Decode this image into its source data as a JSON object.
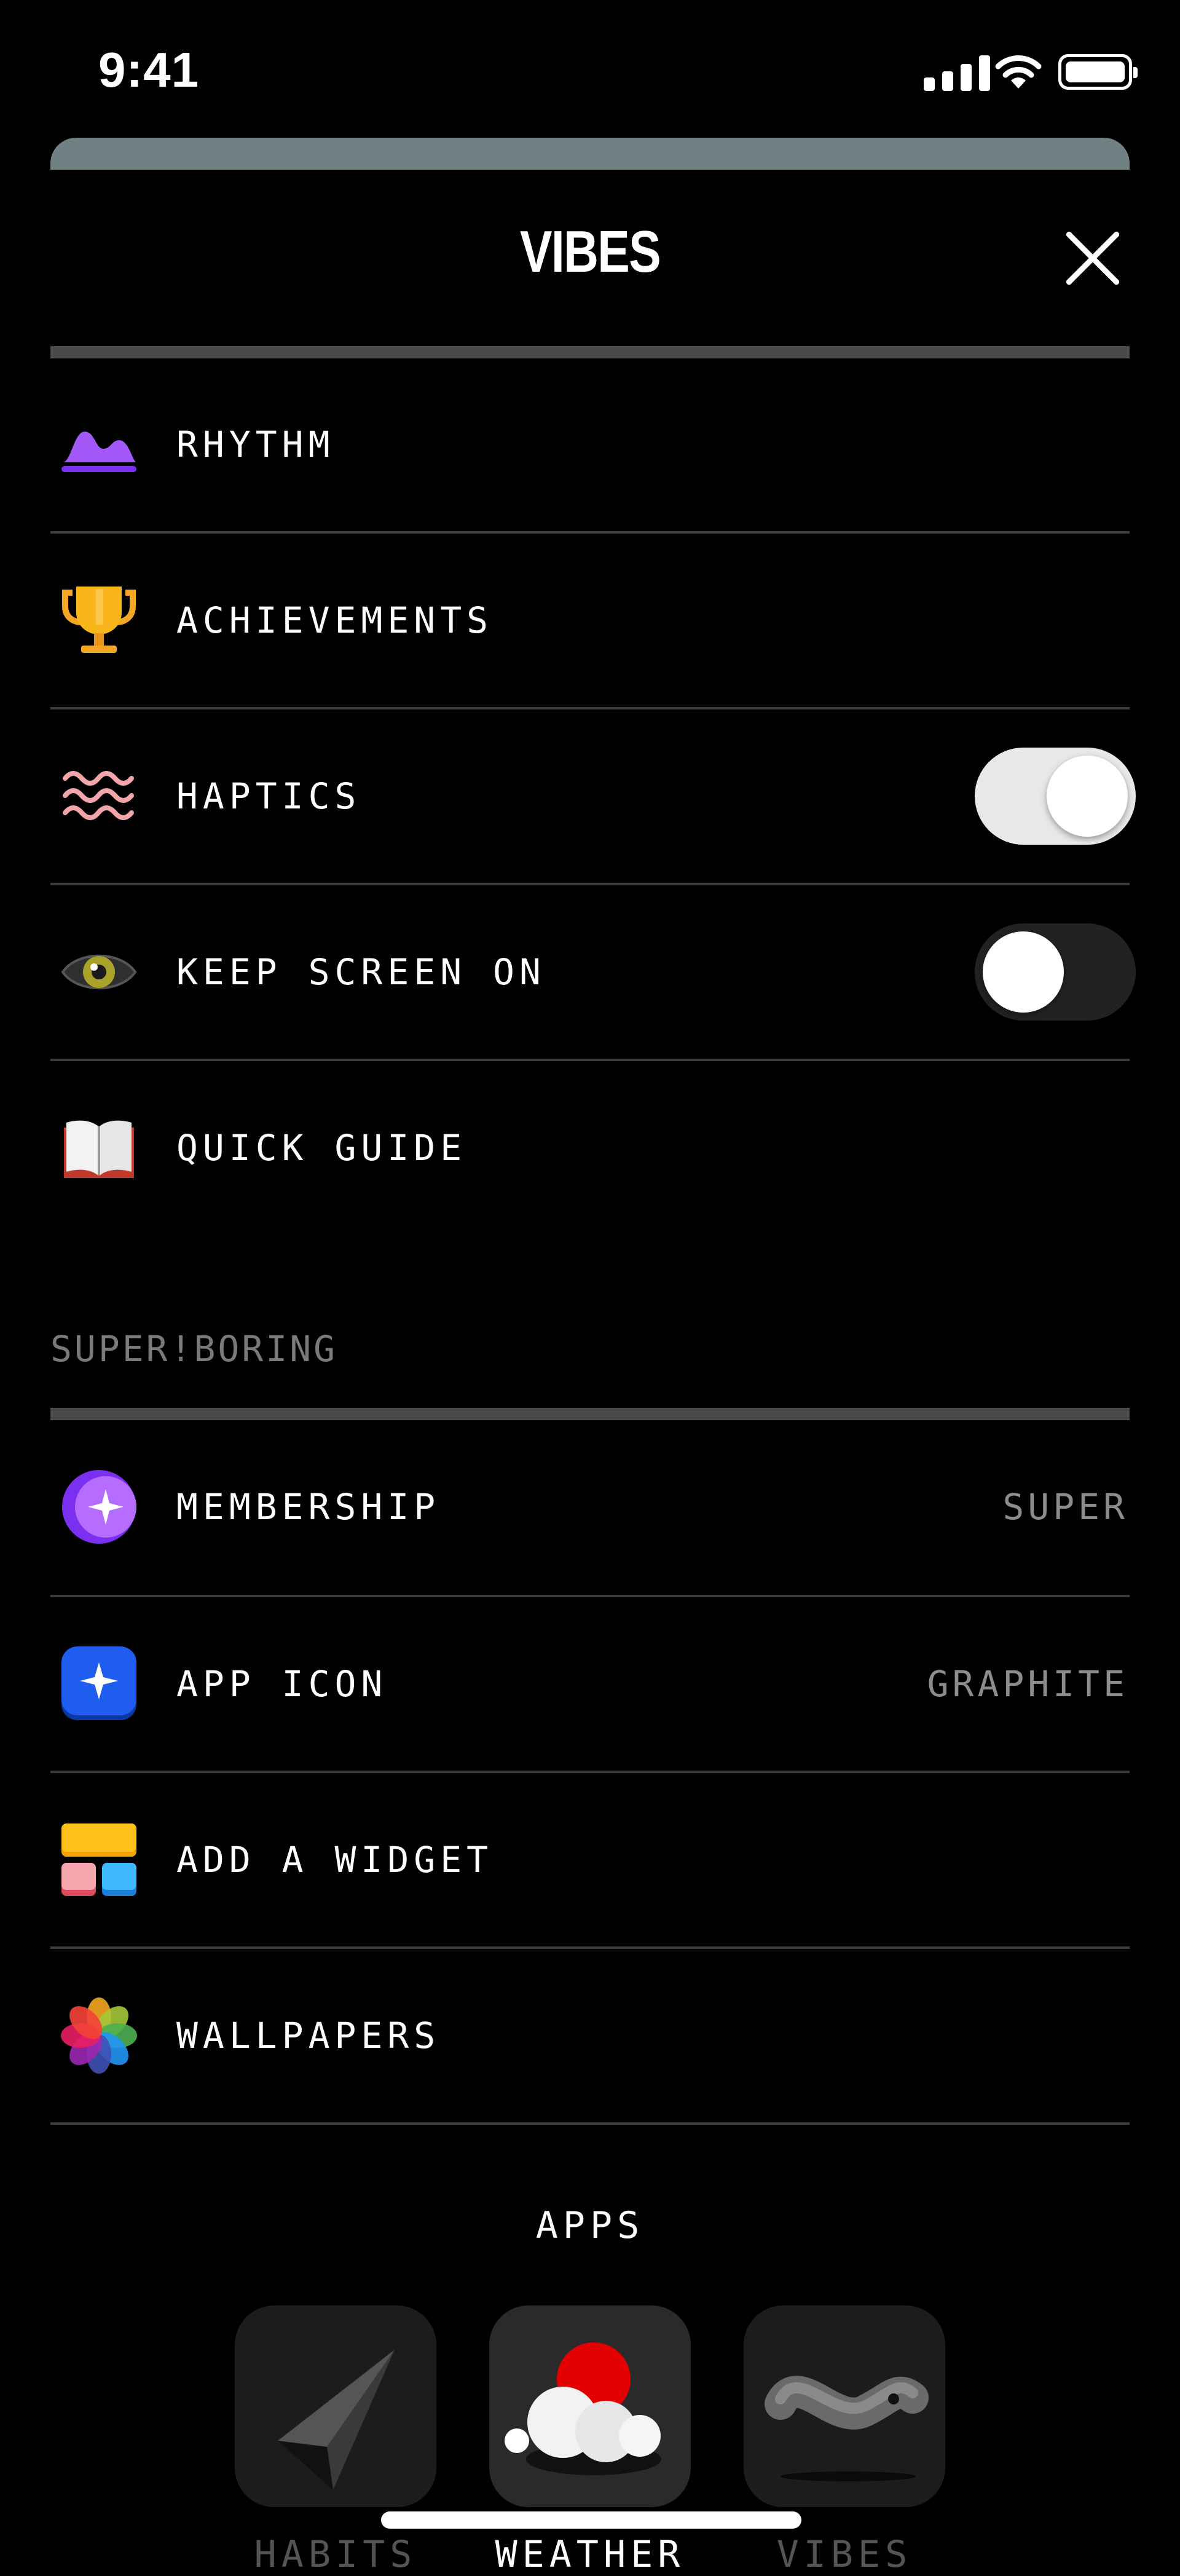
{
  "status_bar": {
    "time": "9:41"
  },
  "sheet": {
    "title": "VIBES"
  },
  "settings": [
    {
      "label": "RHYTHM",
      "icon": "rhythm-wave-icon"
    },
    {
      "label": "ACHIEVEMENTS",
      "icon": "trophy-icon"
    },
    {
      "label": "HAPTICS",
      "icon": "haptic-waves-icon",
      "toggle": true
    },
    {
      "label": "KEEP SCREEN ON",
      "icon": "eye-icon",
      "toggle": false
    },
    {
      "label": "QUICK GUIDE",
      "icon": "open-book-icon"
    }
  ],
  "superboring": {
    "heading": "SUPER!BORING",
    "items": [
      {
        "label": "MEMBERSHIP",
        "value": "SUPER",
        "icon": "membership-moon-icon"
      },
      {
        "label": "APP ICON",
        "value": "GRAPHITE",
        "icon": "app-icon-sparkle-icon"
      },
      {
        "label": "ADD A WIDGET",
        "icon": "widgets-icon"
      },
      {
        "label": "WALLPAPERS",
        "icon": "photos-flower-icon"
      }
    ]
  },
  "apps": {
    "title": "APPS",
    "items": [
      {
        "label": "HABITS",
        "icon": "paper-plane-icon"
      },
      {
        "label": "WEATHER",
        "icon": "weather-cloud-icon"
      },
      {
        "label": "VIBES",
        "icon": "squiggle-icon"
      }
    ]
  },
  "colors": {
    "background": "#000000",
    "toggle_on": "#e8e8e8",
    "toggle_off": "#222222",
    "muted_text": "#8c8c8c"
  }
}
